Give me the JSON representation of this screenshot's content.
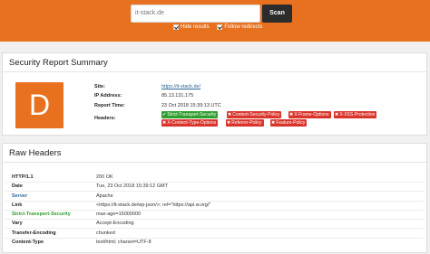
{
  "search": {
    "value": "it-stack.de",
    "button": "Scan"
  },
  "options": [
    {
      "label": "Hide results",
      "checked": true
    },
    {
      "label": "Follow redirects",
      "checked": true
    }
  ],
  "summary": {
    "title": "Security Report Summary",
    "grade": "D",
    "grade_color": "#e8711f",
    "site_label": "Site:",
    "site_value": "https://it-stack.de/",
    "ip_label": "IP Address:",
    "ip_value": "85.13.131.175",
    "time_label": "Report Time:",
    "time_value": "23 Oct 2018 15:39:13 UTC",
    "headers_label": "Headers:",
    "headers": [
      {
        "name": "Strict-Transport-Security",
        "status": "present",
        "icon": "check-icon"
      },
      {
        "name": "Content-Security-Policy",
        "status": "missing",
        "icon": "cross-icon"
      },
      {
        "name": "X-Frame-Options",
        "status": "missing",
        "icon": "cross-icon"
      },
      {
        "name": "X-XSS-Protection",
        "status": "missing",
        "icon": "cross-icon"
      },
      {
        "name": "X-Content-Type-Options",
        "status": "missing",
        "icon": "cross-icon"
      },
      {
        "name": "Referrer-Policy",
        "status": "missing",
        "icon": "cross-icon"
      },
      {
        "name": "Feature-Policy",
        "status": "missing",
        "icon": "cross-icon"
      }
    ]
  },
  "raw": {
    "title": "Raw Headers",
    "rows": [
      {
        "key": "HTTP/1.1",
        "value": "200 OK"
      },
      {
        "key": "Date",
        "value": "Tue, 23 Oct 2018 15:39:12 GMT"
      },
      {
        "key": "Server",
        "value": "Apache"
      },
      {
        "key": "Link",
        "value": "<https://it-stack.de/wp-json/>; rel=\"https://api.w.org/\""
      },
      {
        "key": "Strict-Transport-Security",
        "value": "max-age=15000000"
      },
      {
        "key": "Vary",
        "value": "Accept-Encoding"
      },
      {
        "key": "Transfer-Encoding",
        "value": "chunked"
      },
      {
        "key": "Content-Type",
        "value": "text/html; charset=UTF-8"
      }
    ]
  },
  "colors": {
    "accent": "#e8711f",
    "ok": "#2e9e2e",
    "bad": "#d9352c",
    "link": "#2a6496"
  }
}
